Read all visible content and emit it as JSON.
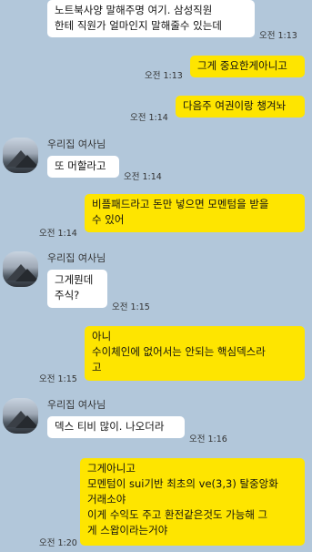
{
  "sender_name": "우리집 여사님",
  "messages": [
    {
      "text": "노트북사양 말해주명  여기. 삼성직원\n한테 직원가 얼마인지 말해줄수 있는데",
      "time": "오전 1:13"
    },
    {
      "text": "그게 중요한게아니고",
      "time": "오전 1:13"
    },
    {
      "text": "다음주 여권이랑 챙겨놔",
      "time": "오전 1:14"
    },
    {
      "text": "또 머할라고",
      "time": "오전 1:14"
    },
    {
      "text": "비플패드라고 돈만 넣으면 모멘텀을 받을\n수 있어",
      "time": "오전 1:14"
    },
    {
      "text": "그게뭔데\n주식?",
      "time": "오전 1:15"
    },
    {
      "text": "아니\n수이체인에 없어서는 안되는 핵심덱스라\n고",
      "time": "오전 1:15"
    },
    {
      "text": "덱스 티비 많이. 나오더라",
      "time": "오전 1:16"
    },
    {
      "text": "그게아니고\n모멘텀이 sui기반 최초의 ve(3,3) 탈중앙화\n거래소야\n이게 수익도 주고 환전같은것도 가능해 그\n게 스왑이라는거야",
      "time": "오전 1:20"
    }
  ],
  "colors": {
    "background": "#b2c7da",
    "incoming_bubble": "#ffffff",
    "outgoing_bubble": "#fee500"
  },
  "icons": {
    "avatar": "mountain-avatar"
  }
}
